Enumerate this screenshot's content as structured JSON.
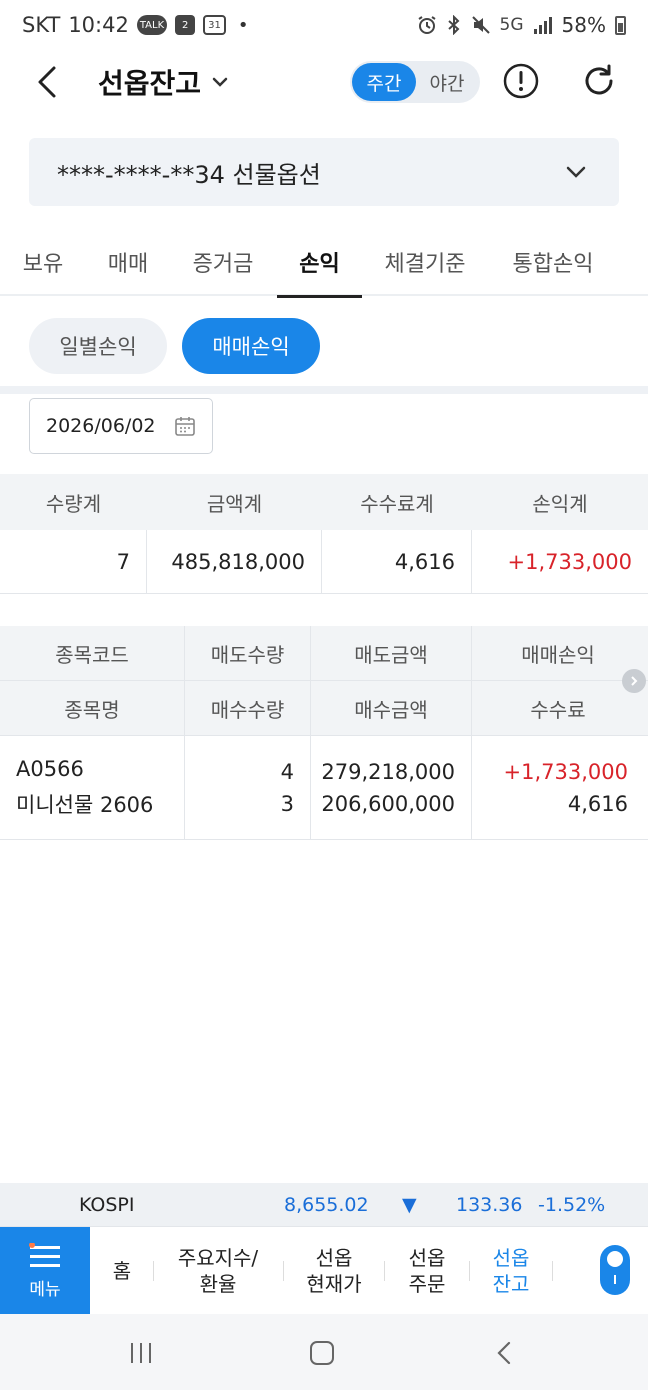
{
  "status_bar": {
    "carrier": "SKT",
    "time": "10:42",
    "notif_talk": "TALK",
    "notif_badge": "2",
    "notif_cal": "31",
    "dot": "•",
    "net": "5G",
    "battery": "58%"
  },
  "header": {
    "title": "선옵잔고",
    "toggle_day": "주간",
    "toggle_night": "야간"
  },
  "account": {
    "label": "****-****-**34 선물옵션"
  },
  "tabs": [
    "보유",
    "매매",
    "증거금",
    "손익",
    "체결기준",
    "통합손익"
  ],
  "active_tab": "손익",
  "subtabs": {
    "daily": "일별손익",
    "trade": "매매손익"
  },
  "date": "2026/06/02",
  "summary": {
    "headers": [
      "수량계",
      "금액계",
      "수수료계",
      "손익계"
    ],
    "values": [
      "7",
      "485,818,000",
      "4,616",
      "+1,733,000"
    ]
  },
  "detail": {
    "header_row1": [
      "종목코드",
      "매도수량",
      "매도금액",
      "매매손익"
    ],
    "header_row2": [
      "종목명",
      "매수수량",
      "매수금액",
      "수수료"
    ],
    "row": {
      "code": "A0566",
      "name": "미니선물 2606",
      "sell_qty": "4",
      "buy_qty": "3",
      "sell_amount": "279,218,000",
      "buy_amount": "206,600,000",
      "trade_pl": "+1,733,000",
      "fee": "4,616"
    }
  },
  "ticker": {
    "name": "KOSPI",
    "value": "8,655.02",
    "arrow": "▼",
    "change": "133.36",
    "pct": "-1.52%"
  },
  "bottom_nav": {
    "menu": "메뉴",
    "items": [
      "홈",
      "주요지수/\n환율",
      "선옵\n현재가",
      "선옵\n주문",
      "선옵\n잔고"
    ]
  },
  "colors": {
    "accent": "#1a86e8",
    "profit": "#d8232a",
    "down": "#1a6ed8"
  }
}
